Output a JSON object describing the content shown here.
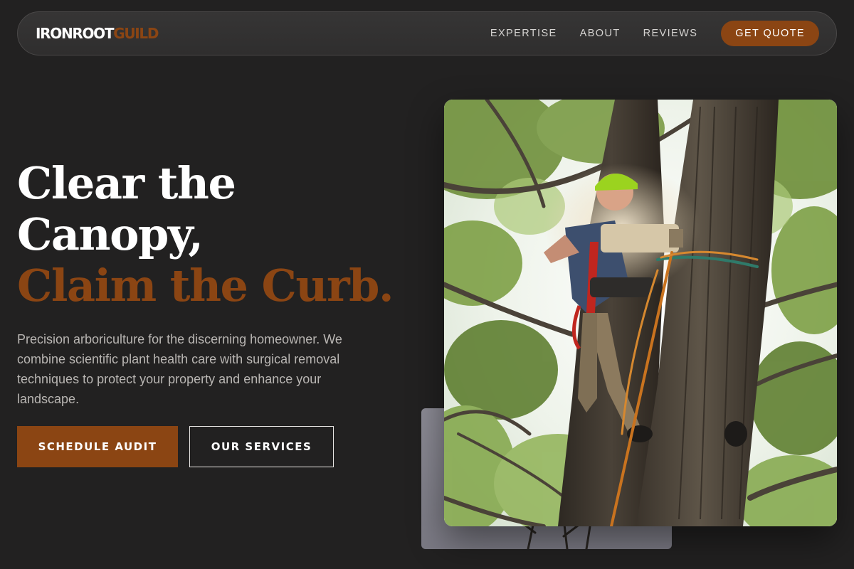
{
  "brand": {
    "name_part1": "IRONROOT",
    "name_part2": "GUILD"
  },
  "nav": {
    "links": [
      "EXPERTISE",
      "ABOUT",
      "REVIEWS"
    ],
    "cta_label": "GET QUOTE"
  },
  "hero": {
    "headline_line1": "Clear the",
    "headline_line2": "Canopy,",
    "headline_accent": "Claim the Curb.",
    "description": "Precision arboriculture for the discerning homeowner. We combine scientific plant health care with surgical removal techniques to protect your property and enhance your landscape.",
    "primary_button": "SCHEDULE AUDIT",
    "secondary_button": "OUR SERVICES"
  },
  "colors": {
    "background": "#222121",
    "accent": "#8b4513",
    "nav_background": "#343333",
    "text_muted": "#b9b6b3"
  },
  "icons": [
    "tree-climber-photo"
  ]
}
